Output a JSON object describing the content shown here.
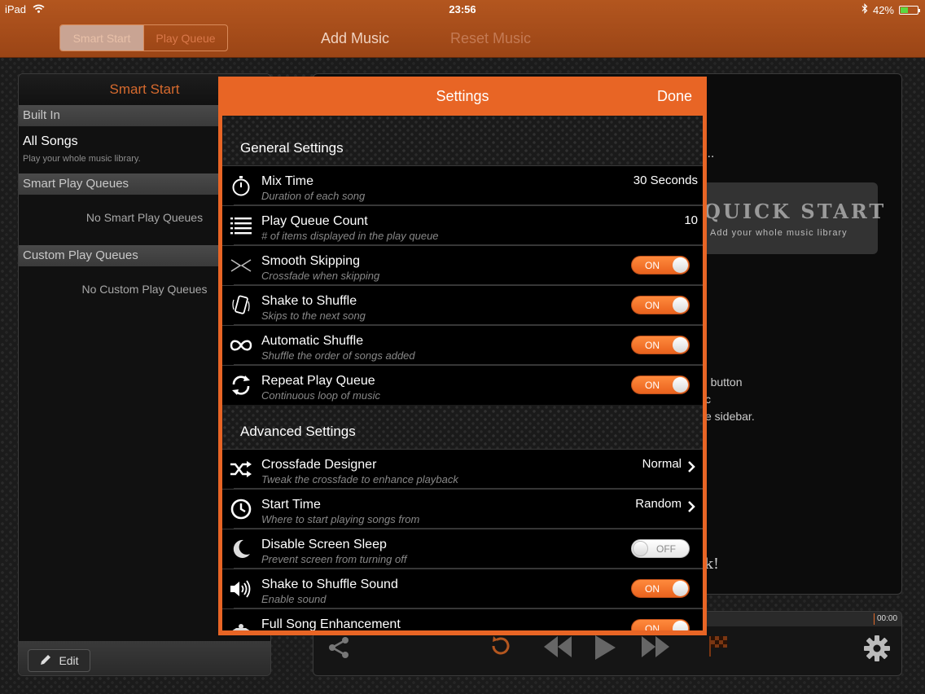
{
  "status_bar": {
    "device": "iPad",
    "time": "23:56",
    "battery": "42%"
  },
  "top_bar": {
    "segments": [
      "Smart Start",
      "Play Queue"
    ],
    "add_music": "Add Music",
    "reset_music": "Reset Music"
  },
  "sidebar": {
    "title": "Smart Start",
    "built_in_header": "Built In",
    "all_songs_title": "All Songs",
    "all_songs_sub": "Play your whole music library.",
    "smart_header": "Smart Play Queues",
    "smart_empty": "No Smart Play Queues",
    "custom_header": "Custom Play Queues",
    "custom_empty": "No Custom Play Queues",
    "edit_label": "Edit"
  },
  "background": {
    "dots": "...",
    "quick_start_title": "QUICK START",
    "quick_start_sub": "Add your whole music library",
    "line1": "' button",
    "line2": "c",
    "line3": "e sidebar.",
    "bang": "k!",
    "player_time": "00:00"
  },
  "settings": {
    "title": "Settings",
    "done": "Done",
    "general_header": "General Settings",
    "advanced_header": "Advanced Settings",
    "general": [
      {
        "icon": "stopwatch-icon",
        "title": "Mix Time",
        "subtitle": "Duration of each song",
        "value": "30 Seconds"
      },
      {
        "icon": "list-icon",
        "title": "Play Queue Count",
        "subtitle": "# of items displayed in the play queue",
        "value": "10"
      },
      {
        "icon": "crossfade-icon",
        "title": "Smooth Skipping",
        "subtitle": "Crossfade when skipping",
        "toggle": "ON"
      },
      {
        "icon": "shake-phone-icon",
        "title": "Shake to Shuffle",
        "subtitle": "Skips to the next song",
        "toggle": "ON"
      },
      {
        "icon": "infinity-icon",
        "title": "Automatic Shuffle",
        "subtitle": "Shuffle the order of songs added",
        "toggle": "ON"
      },
      {
        "icon": "repeat-icon",
        "title": "Repeat Play Queue",
        "subtitle": "Continuous loop of music",
        "toggle": "ON"
      }
    ],
    "advanced": [
      {
        "icon": "shuffle-icon",
        "title": "Crossfade Designer",
        "subtitle": "Tweak the crossfade to enhance playback",
        "value": "Normal"
      },
      {
        "icon": "clock-icon",
        "title": "Start Time",
        "subtitle": "Where to start playing songs from",
        "value": "Random"
      },
      {
        "icon": "moon-icon",
        "title": "Disable Screen Sleep",
        "subtitle": "Prevent screen from turning off",
        "toggle": "OFF"
      },
      {
        "icon": "speaker-icon",
        "title": "Shake to Shuffle Sound",
        "subtitle": "Enable sound",
        "toggle": "ON"
      },
      {
        "icon": "enhancement-icon",
        "title": "Full Song Enhancement",
        "subtitle": "",
        "toggle": "ON"
      }
    ]
  }
}
